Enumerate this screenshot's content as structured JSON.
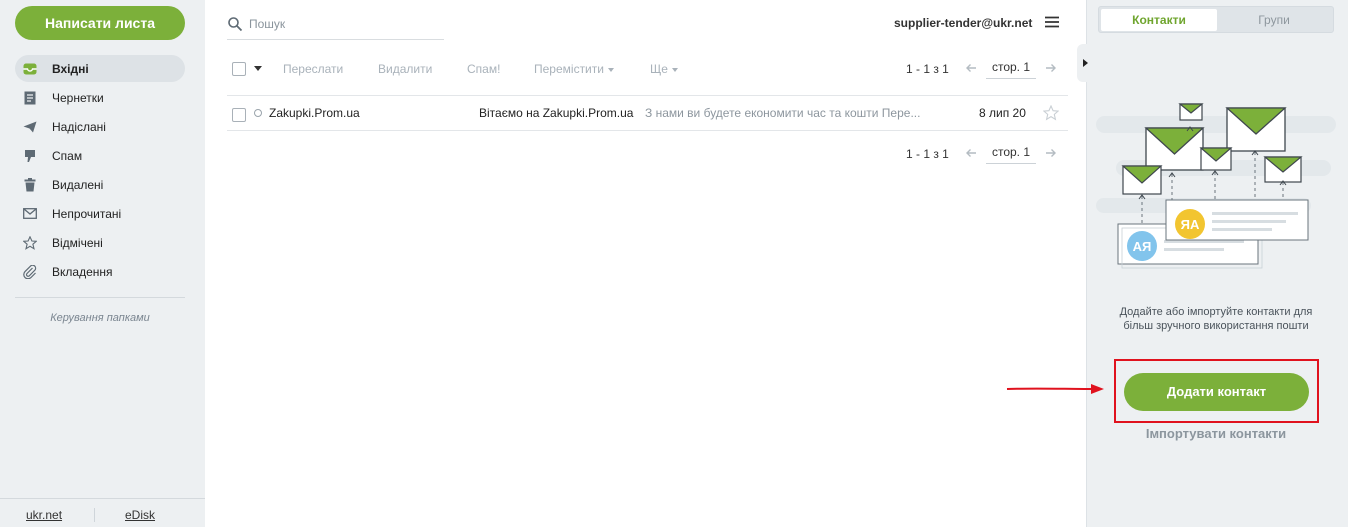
{
  "sidebar": {
    "compose_label": "Написати листа",
    "folders": [
      {
        "label": "Вхідні",
        "icon": "inbox-icon",
        "active": true
      },
      {
        "label": "Чернетки",
        "icon": "drafts-icon"
      },
      {
        "label": "Надіслані",
        "icon": "sent-icon"
      },
      {
        "label": "Спам",
        "icon": "spam-icon"
      },
      {
        "label": "Видалені",
        "icon": "trash-icon"
      },
      {
        "label": "Непрочитані",
        "icon": "unread-icon"
      },
      {
        "label": "Відмічені",
        "icon": "star-icon"
      },
      {
        "label": "Вкладення",
        "icon": "attachment-icon"
      }
    ],
    "manage_folders": "Керування папками",
    "footer_links": [
      "ukr.net",
      "eDisk"
    ]
  },
  "header": {
    "search_placeholder": "Пошук",
    "account": "supplier-tender@ukr.net"
  },
  "toolbar": {
    "forward": "Переслати",
    "delete": "Видалити",
    "spam": "Спам!",
    "move": "Перемістити",
    "more": "Ще",
    "range": "1 - 1 з 1",
    "page_label": "стор. 1"
  },
  "messages": [
    {
      "sender": "Zakupki.Prom.ua",
      "subject": "Вітаємо на Zakupki.Prom.ua",
      "snippet": "З нами ви будете економити час та кошти Пере...",
      "date": "8 лип 20"
    }
  ],
  "contacts_panel": {
    "tabs": [
      "Контакти",
      "Групи"
    ],
    "active_tab": "Контакти",
    "empty_text_line1": "Додайте або імпортуйте контакти для",
    "empty_text_line2": "більш зручного використання пошти",
    "add_contact": "Додати контакт",
    "import_contacts": "Імпортувати контакти",
    "card_initials": [
      "ЯА",
      "АЯ"
    ]
  },
  "colors": {
    "accent_green": "#7cb03a",
    "highlight_red": "#e0121e",
    "sidebar_bg": "#edf0f2"
  }
}
